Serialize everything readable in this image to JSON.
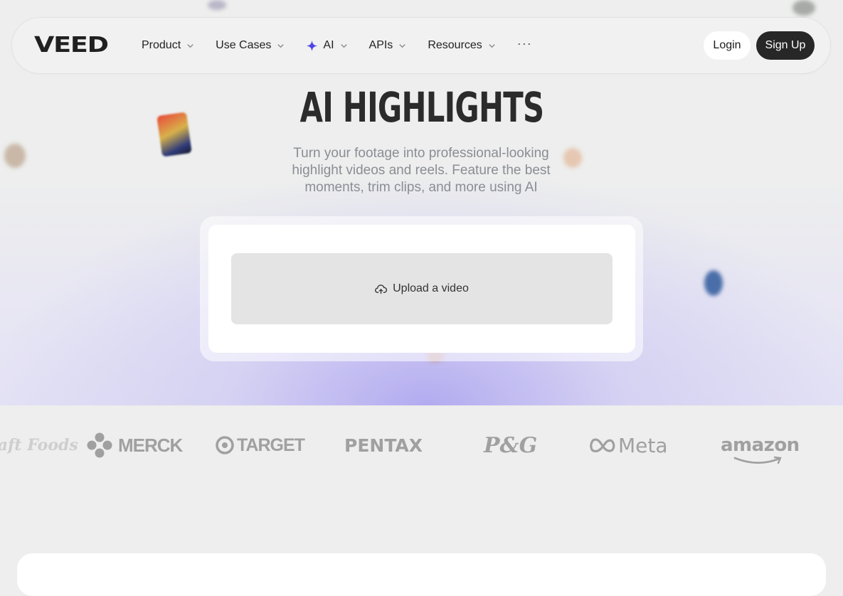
{
  "nav": {
    "logo": "VEED",
    "menu": [
      {
        "label": "Product"
      },
      {
        "label": "Use Cases"
      },
      {
        "label": "AI"
      },
      {
        "label": "APIs"
      },
      {
        "label": "Resources"
      }
    ],
    "more": "···",
    "login": "Login",
    "signup": "Sign Up"
  },
  "hero": {
    "title": "AI HIGHLIGHTS",
    "subtitle": "Turn your footage into professional-looking highlight videos and reels. Feature the best moments, trim clips, and more using AI",
    "upload_label": "Upload a video"
  },
  "logos": [
    "Kraft Foods",
    "MERCK",
    "TARGET",
    "PENTAX",
    "P&G",
    "Meta",
    "amazon"
  ],
  "colors": {
    "background": "#edeeed",
    "accent_gradient": "#b0a8f0",
    "signup_bg": "#272727",
    "sparkle": "#4f46e5"
  }
}
